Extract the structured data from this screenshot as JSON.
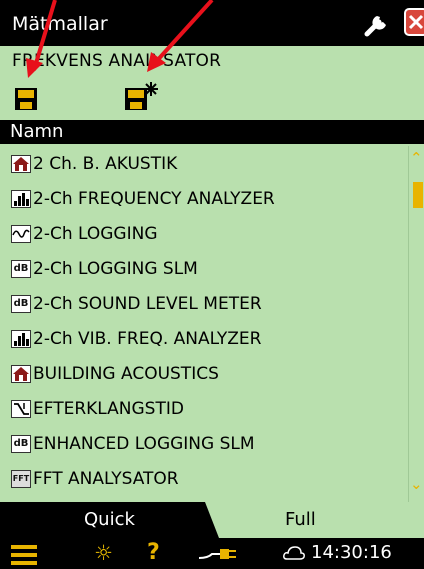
{
  "window": {
    "title": "Mätmallar",
    "subtitle": "FREKVENS ANALYSATOR"
  },
  "toolbar": {
    "settings_icon": "wrench-icon",
    "close_icon": "close-icon",
    "save_icon": "floppy-disk-icon",
    "save_new_icon": "floppy-disk-new-icon"
  },
  "list": {
    "header": "Namn",
    "items": [
      {
        "label": "2 Ch. B. AKUSTIK",
        "icon": "building-acoustics-icon"
      },
      {
        "label": "2-Ch FREQUENCY ANALYZER",
        "icon": "frequency-analyzer-icon"
      },
      {
        "label": "2-Ch LOGGING",
        "icon": "logging-icon"
      },
      {
        "label": "2-Ch LOGGING SLM",
        "icon": "logging-slm-icon",
        "icon_text": "dB"
      },
      {
        "label": "2-Ch SOUND LEVEL METER",
        "icon": "sound-level-meter-icon",
        "icon_text": "dB"
      },
      {
        "label": "2-Ch VIB. FREQ. ANALYZER",
        "icon": "frequency-analyzer-icon"
      },
      {
        "label": "BUILDING ACOUSTICS",
        "icon": "building-acoustics-icon"
      },
      {
        "label": "EFTERKLANGSTID",
        "icon": "reverberation-time-icon"
      },
      {
        "label": "ENHANCED LOGGING SLM",
        "icon": "logging-slm-icon",
        "icon_text": "dB"
      },
      {
        "label": "FFT ANALYSATOR",
        "icon": "fft-icon",
        "icon_text": "FFT"
      }
    ]
  },
  "tabs": {
    "quick": "Quick",
    "full": "Full",
    "active": "Full"
  },
  "status": {
    "menu_icon": "menu-icon",
    "brightness_icon": "brightness-icon",
    "help_icon": "help-icon",
    "help_glyph": "?",
    "power_icon": "power-plug-icon",
    "cloud_icon": "cloud-icon",
    "time": "14:30:16"
  },
  "colors": {
    "background": "#b9e0ae",
    "bar": "#000000",
    "accent": "#e8b400",
    "close": "#d8473c",
    "annotation": "#e8101b"
  }
}
